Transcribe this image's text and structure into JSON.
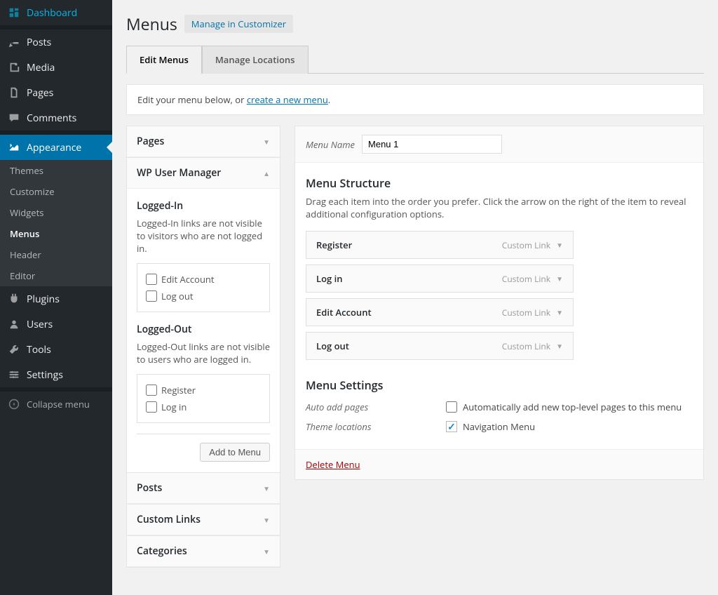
{
  "sidebar": {
    "items": [
      {
        "label": "Dashboard",
        "icon": "dashboard"
      },
      {
        "label": "Posts",
        "icon": "pin"
      },
      {
        "label": "Media",
        "icon": "media"
      },
      {
        "label": "Pages",
        "icon": "pages"
      },
      {
        "label": "Comments",
        "icon": "comments"
      },
      {
        "label": "Appearance",
        "icon": "appearance",
        "active": true
      },
      {
        "label": "Plugins",
        "icon": "plugins"
      },
      {
        "label": "Users",
        "icon": "users"
      },
      {
        "label": "Tools",
        "icon": "tools"
      },
      {
        "label": "Settings",
        "icon": "settings"
      }
    ],
    "sub_items": [
      "Themes",
      "Customize",
      "Widgets",
      "Menus",
      "Header",
      "Editor"
    ],
    "sub_current": "Menus",
    "collapse": "Collapse menu"
  },
  "page": {
    "title": "Menus",
    "customizer_link": "Manage in Customizer"
  },
  "tabs": {
    "edit": "Edit Menus",
    "locations": "Manage Locations"
  },
  "info": {
    "prefix": "Edit your menu below, or ",
    "link": "create a new menu",
    "suffix": "."
  },
  "accordion": {
    "pages": "Pages",
    "wp_user_manager": {
      "title": "WP User Manager",
      "logged_in": {
        "label": "Logged-In",
        "desc": "Logged-In links are not visible to visitors who are not logged in.",
        "options": [
          "Edit Account",
          "Log out"
        ]
      },
      "logged_out": {
        "label": "Logged-Out",
        "desc": "Logged-Out links are not visible to users who are logged in.",
        "options": [
          "Register",
          "Log in"
        ]
      },
      "add_button": "Add to Menu"
    },
    "posts": "Posts",
    "custom_links": "Custom Links",
    "categories": "Categories"
  },
  "menu_edit": {
    "name_label": "Menu Name",
    "name_value": "Menu 1",
    "structure_heading": "Menu Structure",
    "structure_desc": "Drag each item into the order you prefer. Click the arrow on the right of the item to reveal additional configuration options.",
    "items": [
      {
        "title": "Register",
        "type": "Custom Link"
      },
      {
        "title": "Log in",
        "type": "Custom Link"
      },
      {
        "title": "Edit Account",
        "type": "Custom Link"
      },
      {
        "title": "Log out",
        "type": "Custom Link"
      }
    ],
    "settings": {
      "heading": "Menu Settings",
      "auto_add_label": "Auto add pages",
      "auto_add_option": "Automatically add new top-level pages to this menu",
      "theme_loc_label": "Theme locations",
      "theme_loc_option": "Navigation Menu"
    },
    "delete": "Delete Menu"
  }
}
